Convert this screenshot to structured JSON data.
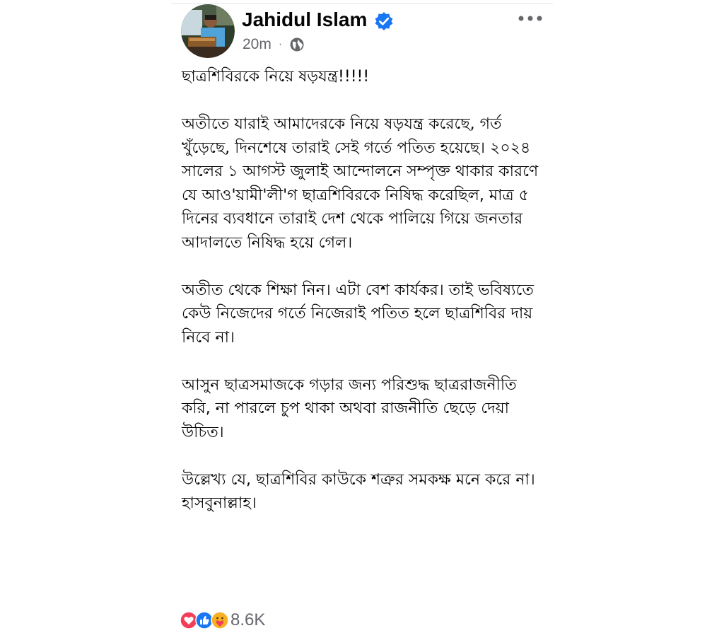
{
  "post": {
    "author": "Jahidul Islam",
    "time": "20m",
    "separator": "·",
    "privacy_icon": "globe-icon",
    "verified_icon": "verified-badge-icon",
    "more_icon": "more-options-icon",
    "paragraphs": [
      "ছাত্রশিবিরকে নিয়ে ষড়যন্ত্র!!!!!",
      "অতীতে যারাই আমাদেরকে নিয়ে ষড়যন্ত্র করেছে, গর্ত খুঁড়েছে, দিনশেষে তারাই সেই গর্তে পতিত হয়েছে। ২০২৪ সালের ১ আগস্ট জুলাই আন্দোলনে সম্পৃক্ত থাকার কারণে যে আও'য়ামী'লী'গ ছাত্রশিবিরকে নিষিদ্ধ করেছিল, মাত্র ৫ দিনের ব্যবধানে তারাই দেশ থেকে পালিয়ে গিয়ে জনতার আদালতে নিষিদ্ধ হয়ে গেল।",
      "অতীত থেকে শিক্ষা নিন। এটা বেশ কার্যকর। তাই ভবিষ্যতে কেউ নিজেদের গর্তে নিজেরাই পতিত হলে ছাত্রশিবির দায় নিবে না।",
      "আসুন ছাত্রসমাজকে গড়ার জন্য পরিশুদ্ধ ছাত্ররাজনীতি করি, না পারলে চুপ থাকা অথবা রাজনীতি ছেড়ে দেয়া উচিত।",
      "উল্লেখ্য যে, ছাত্রশিবির কাউকে শত্রুর সমকক্ষ মনে করে না। হাসবুনাল্লাহ।"
    ],
    "reactions": {
      "icons": [
        "love-reaction-icon",
        "like-reaction-icon",
        "care-reaction-icon"
      ],
      "count": "8.6K"
    },
    "colors": {
      "verified_blue": "#1877f2",
      "secondary_text": "#65676b",
      "love_red": "#f33e58",
      "care_yellow": "#f7b125"
    }
  }
}
